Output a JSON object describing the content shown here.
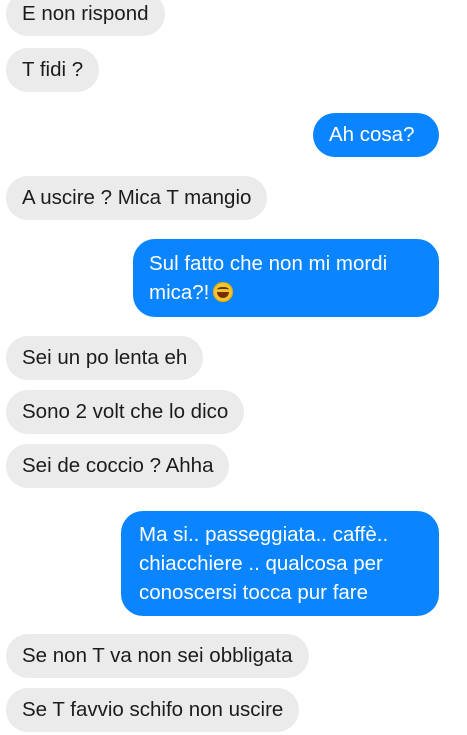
{
  "messages": [
    {
      "side": "received",
      "text": "E non rispond"
    },
    {
      "side": "received",
      "text": "T fidi ?"
    },
    {
      "side": "sent",
      "text": "Ah cosa?"
    },
    {
      "side": "received",
      "text": "A uscire ? Mica T mangio"
    },
    {
      "side": "sent",
      "text": "Sul fatto che non mi mordi mica?!",
      "emoji": "grinning-sweat-emoji"
    },
    {
      "side": "received",
      "text": "Sei un po lenta eh"
    },
    {
      "side": "received",
      "text": "Sono 2 volt che lo dico"
    },
    {
      "side": "received",
      "text": "Sei de coccio ? Ahha"
    },
    {
      "side": "sent",
      "text": "Ma si.. passeggiata.. caffè.. chiacchiere .. qualcosa per conoscersi tocca pur fare"
    },
    {
      "side": "received",
      "text": "Se non T va non sei obbligata"
    },
    {
      "side": "received",
      "text": "Se T favvio schifo non uscire"
    }
  ],
  "colors": {
    "sent_bubble": "#0a84ff",
    "received_bubble": "#ebebeb",
    "sent_text": "#ffffff",
    "received_text": "#1c1c1c"
  }
}
